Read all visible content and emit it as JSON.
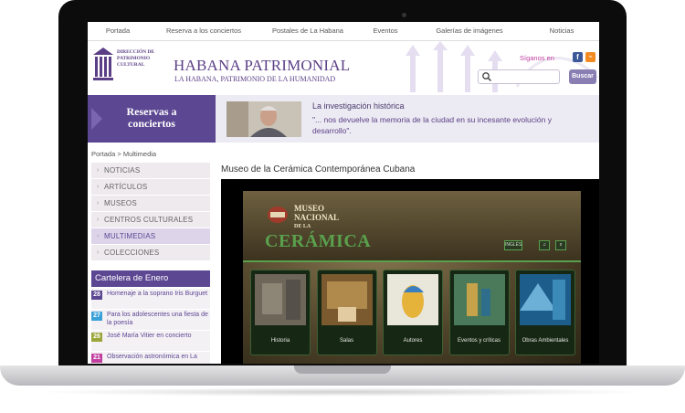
{
  "nav": {
    "items": [
      "Portada",
      "Reserva a los conciertos",
      "Postales de La Habana",
      "Eventos",
      "Galerías de imágenes",
      "Noticias"
    ]
  },
  "header": {
    "logo_line1": "DIRECCIÓN DE",
    "logo_line2": "PATRIMONIO",
    "logo_line3": "CULTURAL",
    "title": "HABANA PATRIMONIAL",
    "subtitle": "LA HABANA, PATRIMONIO DE LA HUMANIDAD",
    "follow_label": "Síganos en",
    "search_placeholder": "",
    "search_button": "Buscar",
    "fb_icon": "facebook-icon",
    "rss_icon": "rss-icon"
  },
  "banner": {
    "reservas_line1": "Reservas a",
    "reservas_line2": "conciertos",
    "quote_title": "La investigación histórica",
    "quote_text": "\"... nos devuelve la memoria de la ciudad en su incesante evolución y desarrollo\"."
  },
  "breadcrumb": "Portada > Multimedia",
  "menu": {
    "items": [
      {
        "label": "NOTICIAS",
        "active": false
      },
      {
        "label": "ARTÍCULOS",
        "active": false
      },
      {
        "label": "MUSEOS",
        "active": false
      },
      {
        "label": "CENTROS CULTURALES",
        "active": false
      },
      {
        "label": "MULTIMEDIAS",
        "active": true
      },
      {
        "label": "COLECCIONES",
        "active": false
      }
    ]
  },
  "cartelera": {
    "title": "Cartelera de Enero",
    "events": [
      {
        "day": "28",
        "text": "Homenaje a la soprano Iris Burguet",
        "color": "#5c4792"
      },
      {
        "day": "27",
        "text": "Para los adolescentes una fiesta de la poesía",
        "color": "#3aa0d8"
      },
      {
        "day": "26",
        "text": "José María Vitier en concierto",
        "color": "#9aa63a"
      },
      {
        "day": "21",
        "text": "Observación astronómica en La",
        "color": "#c23fa0"
      }
    ]
  },
  "main": {
    "title": "Museo de la Cerámica Contemporánea Cubana",
    "video": {
      "museo_line1": "MUSEO",
      "museo_line2": "NACIONAL",
      "museo_line3": "DE LA",
      "ceramica": "CERÁMICA",
      "ctrl_lang": "INGLÉS",
      "tiles": [
        "Historia",
        "Salas",
        "Autores",
        "Eventos y críticas",
        "Obras Ambientales"
      ]
    }
  },
  "colors": {
    "accent": "#5c4792",
    "link_pink": "#c23fa0",
    "video_green": "#5aa04d"
  }
}
